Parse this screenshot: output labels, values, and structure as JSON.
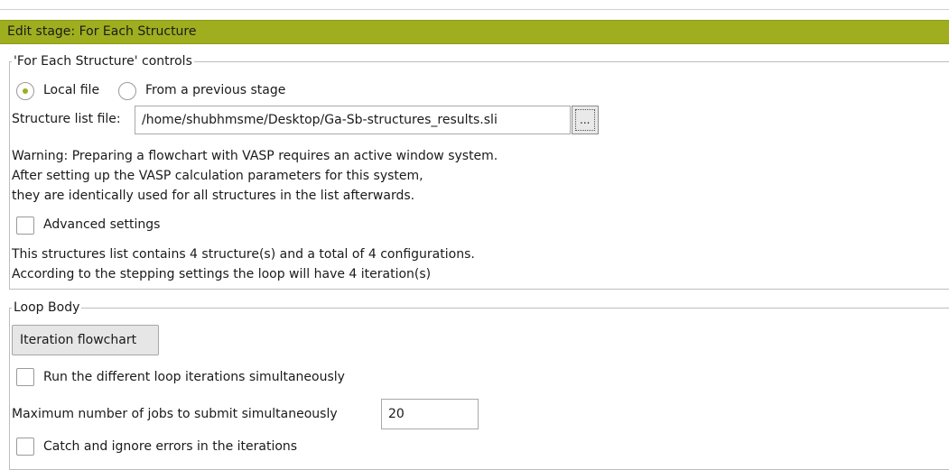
{
  "window": {
    "title": "Edit stage: For Each Structure"
  },
  "for_each_group": {
    "legend": "'For Each Structure' controls",
    "source_options": [
      {
        "label": "Local file",
        "selected": true
      },
      {
        "label": "From a previous stage",
        "selected": false
      }
    ],
    "structure_list_label": "Structure list file:",
    "structure_list_value": "/home/shubhmsme/Desktop/Ga-Sb-structures_results.sli",
    "browse_label": "...",
    "warning_lines": [
      "Warning: Preparing a flowchart with VASP requires an active window system.",
      "After setting up the VASP calculation parameters for this system,",
      "they are identically used for all structures in the list afterwards."
    ],
    "advanced_settings_label": "Advanced settings",
    "advanced_settings_checked": false,
    "summary_lines": [
      "This structures list contains 4 structure(s) and a total of 4 configurations.",
      "According to the stepping settings the loop will have 4 iteration(s)"
    ]
  },
  "loop_body_group": {
    "legend": "Loop Body",
    "iteration_button_label": "Iteration flowchart",
    "run_simultaneously_label": "Run the different loop iterations simultaneously",
    "run_simultaneously_checked": false,
    "max_jobs_label": "Maximum number of jobs to submit simultaneously",
    "max_jobs_value": "20",
    "catch_errors_label": "Catch and ignore errors in the iterations",
    "catch_errors_checked": false
  },
  "colors": {
    "title_bar": "#9fae1e",
    "radio_selected": "#9fae1e"
  }
}
